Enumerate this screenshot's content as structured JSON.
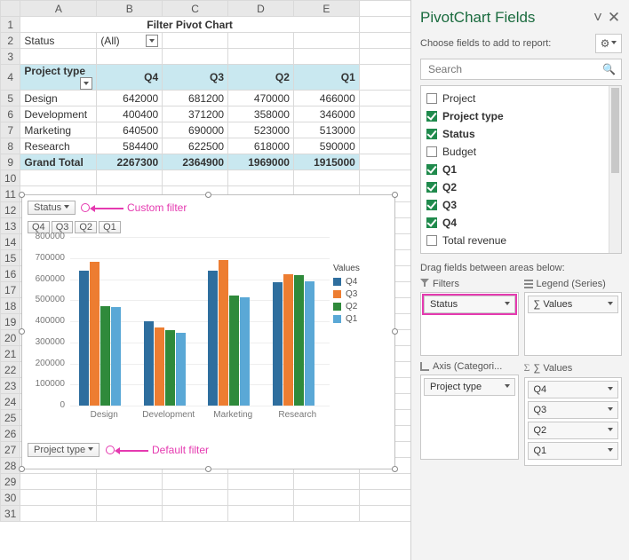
{
  "columns": [
    "A",
    "B",
    "C",
    "D",
    "E"
  ],
  "title": "Filter Pivot Chart",
  "status_filter": {
    "label": "Status",
    "value": "(All)"
  },
  "table": {
    "headers": [
      "Project type",
      "Q4",
      "Q3",
      "Q2",
      "Q1"
    ],
    "rows": [
      {
        "name": "Design",
        "vals": [
          642000,
          681200,
          470000,
          466000
        ]
      },
      {
        "name": "Development",
        "vals": [
          400400,
          371200,
          358000,
          346000
        ]
      },
      {
        "name": "Marketing",
        "vals": [
          640500,
          690000,
          523000,
          513000
        ]
      },
      {
        "name": "Research",
        "vals": [
          584400,
          622500,
          618000,
          590000
        ]
      }
    ],
    "total": {
      "name": "Grand Total",
      "vals": [
        2267300,
        2364900,
        1969000,
        1915000
      ]
    }
  },
  "callouts": {
    "status": "Custom filter",
    "project": "Default filter"
  },
  "chart_buttons": {
    "status": "Status",
    "project": "Project type",
    "legend_buttons": [
      "Q4",
      "Q3",
      "Q2",
      "Q1"
    ]
  },
  "chart_data": {
    "type": "bar",
    "categories": [
      "Design",
      "Development",
      "Marketing",
      "Research"
    ],
    "series": [
      {
        "name": "Q4",
        "color": "#2e6e9e",
        "values": [
          642000,
          400400,
          640500,
          584400
        ]
      },
      {
        "name": "Q3",
        "color": "#ed7d31",
        "values": [
          681200,
          371200,
          690000,
          622500
        ]
      },
      {
        "name": "Q2",
        "color": "#2f8a3b",
        "values": [
          470000,
          358000,
          523000,
          618000
        ]
      },
      {
        "name": "Q1",
        "color": "#5aa8d6",
        "values": [
          466000,
          346000,
          513000,
          590000
        ]
      }
    ],
    "ylabel": "",
    "xlabel": "",
    "ylim": [
      0,
      800000
    ],
    "yticks": [
      0,
      100000,
      200000,
      300000,
      400000,
      500000,
      600000,
      700000,
      800000
    ],
    "legend_title": "Values"
  },
  "pane": {
    "title": "PivotChart Fields",
    "subtitle": "Choose fields to add to report:",
    "search_placeholder": "Search",
    "fields": [
      {
        "label": "Project",
        "checked": false,
        "bold": false
      },
      {
        "label": "Project type",
        "checked": true,
        "bold": true
      },
      {
        "label": "Status",
        "checked": true,
        "bold": true
      },
      {
        "label": "Budget",
        "checked": false,
        "bold": false
      },
      {
        "label": "Q1",
        "checked": true,
        "bold": true
      },
      {
        "label": "Q2",
        "checked": true,
        "bold": true
      },
      {
        "label": "Q3",
        "checked": true,
        "bold": true
      },
      {
        "label": "Q4",
        "checked": true,
        "bold": true
      },
      {
        "label": "Total revenue",
        "checked": false,
        "bold": false
      }
    ],
    "drag_hint": "Drag fields between areas below:",
    "areas": {
      "filters": {
        "title": "Filters",
        "items": [
          "Status"
        ],
        "highlight": true
      },
      "legend": {
        "title": "Legend (Series)",
        "items": [
          "∑ Values"
        ]
      },
      "axis": {
        "title": "Axis (Categori...",
        "items": [
          "Project type"
        ]
      },
      "values": {
        "title": "∑  Values",
        "items": [
          "Q4",
          "Q3",
          "Q2",
          "Q1"
        ]
      }
    }
  }
}
